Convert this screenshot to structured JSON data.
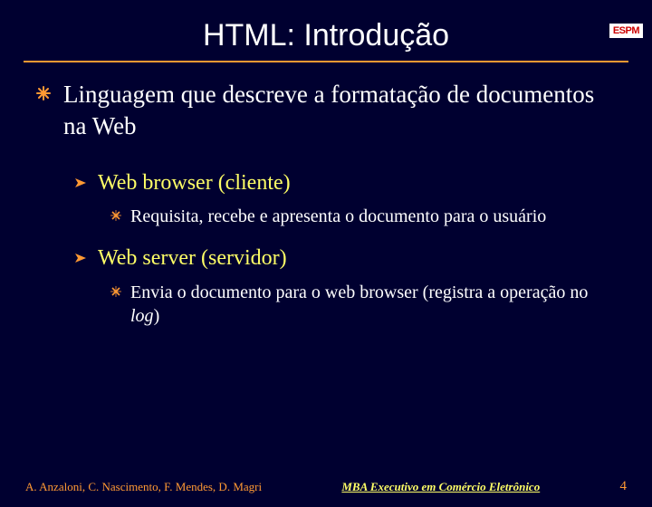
{
  "logo": "ESPM",
  "title": "HTML: Introdução",
  "bullets": {
    "l1": "Linguagem que descreve a formatação de documentos na Web",
    "l2a": "Web browser (cliente)",
    "l3a": "Requisita, recebe e apresenta o documento para o usuário",
    "l2b": "Web server (servidor)",
    "l3b_pre": "Envia o documento para o web browser (registra a operação no ",
    "l3b_em": "log",
    "l3b_post": ")"
  },
  "footer": {
    "left": "A. Anzaloni, C. Nascimento, F. Mendes, D. Magri",
    "mid": "MBA Executivo em Comércio Eletrônico",
    "page": "4"
  },
  "colors": {
    "bg": "#000030",
    "accent": "#ff9933",
    "highlight": "#ffff66",
    "text": "#ffffff"
  }
}
